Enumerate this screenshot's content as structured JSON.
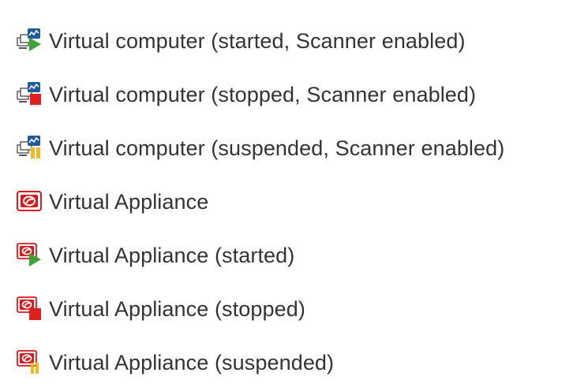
{
  "legend": {
    "items": [
      {
        "icon": "virtual-computer-started-scanner-icon",
        "label": "Virtual computer (started, Scanner enabled)"
      },
      {
        "icon": "virtual-computer-stopped-scanner-icon",
        "label": "Virtual computer (stopped, Scanner enabled)"
      },
      {
        "icon": "virtual-computer-suspended-scanner-icon",
        "label": "Virtual computer (suspended, Scanner enabled)"
      },
      {
        "icon": "virtual-appliance-icon",
        "label": "Virtual Appliance"
      },
      {
        "icon": "virtual-appliance-started-icon",
        "label": "Virtual Appliance (started)"
      },
      {
        "icon": "virtual-appliance-stopped-icon",
        "label": "Virtual Appliance (stopped)"
      },
      {
        "icon": "virtual-appliance-suspended-icon",
        "label": "Virtual Appliance (suspended)"
      }
    ]
  },
  "colors": {
    "text": "#333333",
    "started": "#3aa335",
    "stopped": "#e01f1f",
    "suspended": "#f2b91f",
    "appliance": "#d71920",
    "computer": "#1e5b9c"
  }
}
